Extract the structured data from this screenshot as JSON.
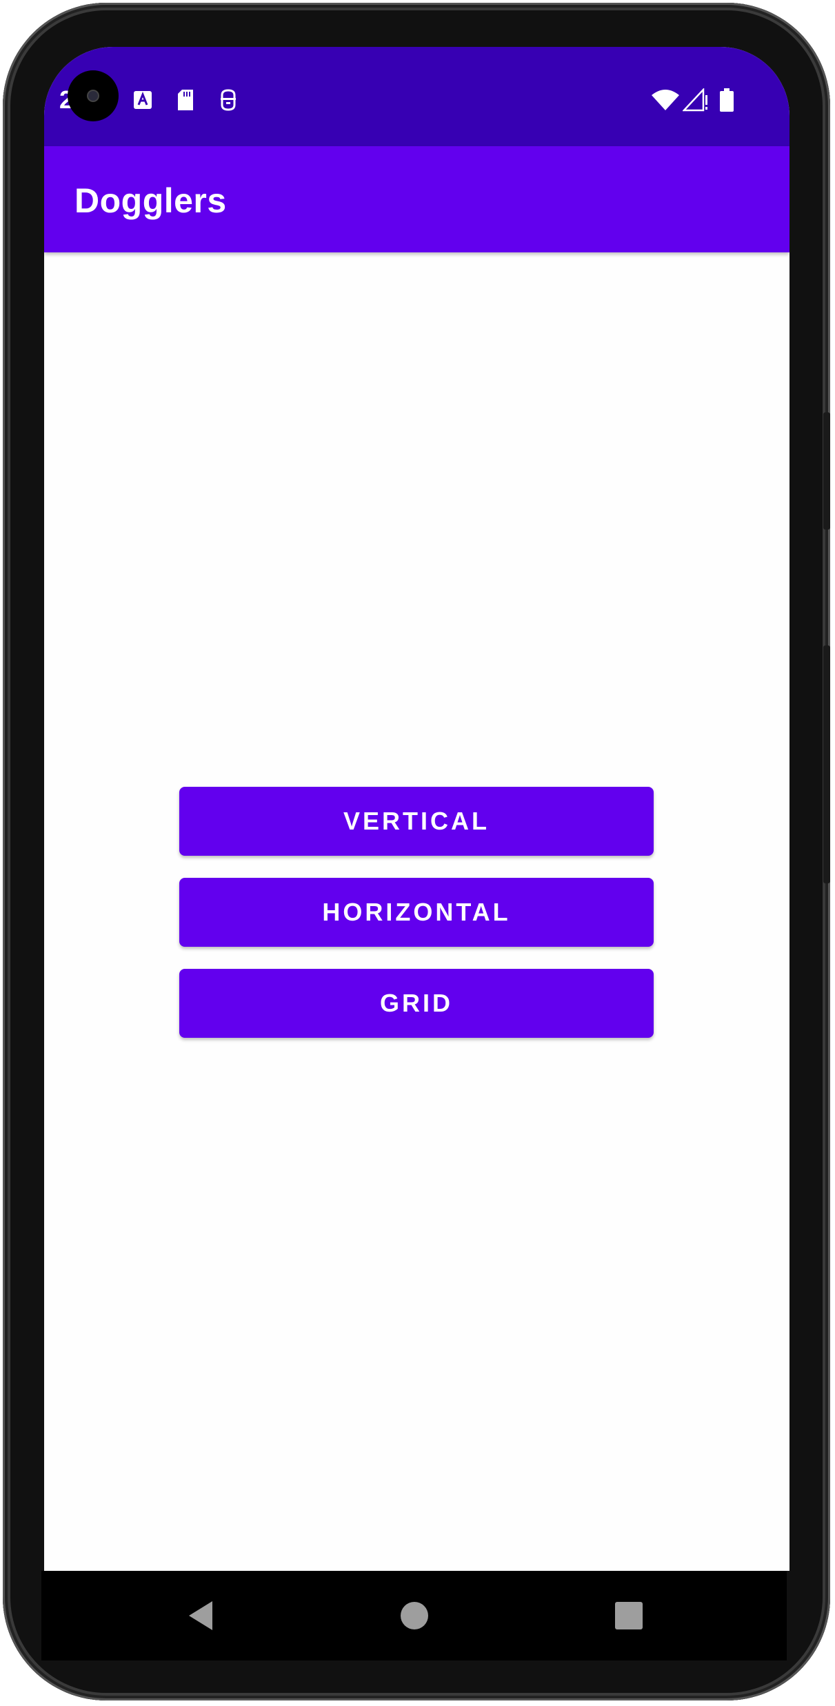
{
  "status_bar": {
    "time": "2",
    "icons": [
      "a-notification-icon",
      "sd-card-icon",
      "app-notification-icon",
      "wifi-icon",
      "signal-icon",
      "battery-icon"
    ]
  },
  "app_bar": {
    "title": "Dogglers"
  },
  "main": {
    "buttons": [
      {
        "label": "VERTICAL"
      },
      {
        "label": "HORIZONTAL"
      },
      {
        "label": "GRID"
      }
    ]
  },
  "nav_bar": {
    "icons": [
      "back-icon",
      "home-icon",
      "recents-icon"
    ]
  },
  "colors": {
    "status_bar": "#3700b3",
    "primary": "#6200ee",
    "background": "#fefefe"
  }
}
